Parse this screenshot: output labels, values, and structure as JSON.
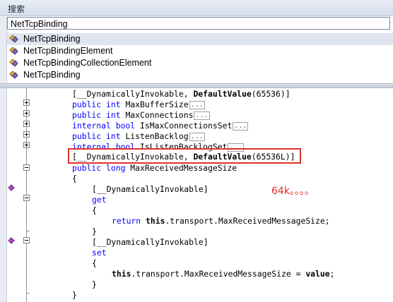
{
  "panel": {
    "title": "搜索"
  },
  "search": {
    "value": "NetTcpBinding"
  },
  "results": [
    {
      "label": "NetTcpBinding",
      "icon": "class-icon"
    },
    {
      "label": "NetTcpBindingElement",
      "icon": "class-icon"
    },
    {
      "label": "NetTcpBindingCollectionElement",
      "icon": "class-icon"
    },
    {
      "label": "NetTcpBinding",
      "icon": "class-icon"
    }
  ],
  "code": {
    "l0_attr": "[__DynamicallyInvokable, ",
    "l0_attr2": "DefaultValue",
    "l0_val": "(65536)]",
    "l1_kw": "public int ",
    "l1_name": "MaxBufferSize",
    "l2_kw": "public int ",
    "l2_name": "MaxConnections",
    "l3_kw": "internal bool ",
    "l3_name": "IsMaxConnectionsSet",
    "l4_kw": "public int ",
    "l4_name": "ListenBacklog",
    "l5_kw": "internal bool ",
    "l5_name": "IsListenBacklogSet",
    "l6_attr": "[__DynamicallyInvokable, ",
    "l6_attr2": "DefaultValue",
    "l6_val": "(65536L)]",
    "l7_kw": "public long ",
    "l7_name": "MaxReceivedMessageSize",
    "l8": "{",
    "l9": "[__DynamicallyInvokable]",
    "l10": "get",
    "l11": "{",
    "l12_kw": "return ",
    "l12_this": "this",
    "l12_rest": ".transport.MaxReceivedMessageSize;",
    "l13": "}",
    "l14": "[__DynamicallyInvokable]",
    "l15": "set",
    "l16": "{",
    "l17_this": "this",
    "l17_mid": ".transport.MaxReceivedMessageSize = ",
    "l17_val": "value",
    "l17_end": ";",
    "l18": "}",
    "l19": "}",
    "ellipsis": "..."
  },
  "annotation": {
    "text": "64k。。。。"
  },
  "colors": {
    "keyword": "#0000ff",
    "attribute": "#2b91af",
    "highlight": "#e0302a"
  }
}
